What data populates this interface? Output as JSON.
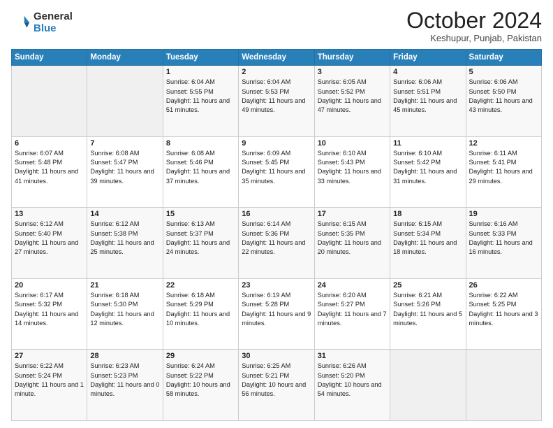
{
  "logo": {
    "general": "General",
    "blue": "Blue"
  },
  "title": "October 2024",
  "location": "Keshupur, Punjab, Pakistan",
  "weekdays": [
    "Sunday",
    "Monday",
    "Tuesday",
    "Wednesday",
    "Thursday",
    "Friday",
    "Saturday"
  ],
  "weeks": [
    [
      {
        "day": "",
        "info": ""
      },
      {
        "day": "",
        "info": ""
      },
      {
        "day": "1",
        "info": "Sunrise: 6:04 AM\nSunset: 5:55 PM\nDaylight: 11 hours and 51 minutes."
      },
      {
        "day": "2",
        "info": "Sunrise: 6:04 AM\nSunset: 5:53 PM\nDaylight: 11 hours and 49 minutes."
      },
      {
        "day": "3",
        "info": "Sunrise: 6:05 AM\nSunset: 5:52 PM\nDaylight: 11 hours and 47 minutes."
      },
      {
        "day": "4",
        "info": "Sunrise: 6:06 AM\nSunset: 5:51 PM\nDaylight: 11 hours and 45 minutes."
      },
      {
        "day": "5",
        "info": "Sunrise: 6:06 AM\nSunset: 5:50 PM\nDaylight: 11 hours and 43 minutes."
      }
    ],
    [
      {
        "day": "6",
        "info": "Sunrise: 6:07 AM\nSunset: 5:48 PM\nDaylight: 11 hours and 41 minutes."
      },
      {
        "day": "7",
        "info": "Sunrise: 6:08 AM\nSunset: 5:47 PM\nDaylight: 11 hours and 39 minutes."
      },
      {
        "day": "8",
        "info": "Sunrise: 6:08 AM\nSunset: 5:46 PM\nDaylight: 11 hours and 37 minutes."
      },
      {
        "day": "9",
        "info": "Sunrise: 6:09 AM\nSunset: 5:45 PM\nDaylight: 11 hours and 35 minutes."
      },
      {
        "day": "10",
        "info": "Sunrise: 6:10 AM\nSunset: 5:43 PM\nDaylight: 11 hours and 33 minutes."
      },
      {
        "day": "11",
        "info": "Sunrise: 6:10 AM\nSunset: 5:42 PM\nDaylight: 11 hours and 31 minutes."
      },
      {
        "day": "12",
        "info": "Sunrise: 6:11 AM\nSunset: 5:41 PM\nDaylight: 11 hours and 29 minutes."
      }
    ],
    [
      {
        "day": "13",
        "info": "Sunrise: 6:12 AM\nSunset: 5:40 PM\nDaylight: 11 hours and 27 minutes."
      },
      {
        "day": "14",
        "info": "Sunrise: 6:12 AM\nSunset: 5:38 PM\nDaylight: 11 hours and 25 minutes."
      },
      {
        "day": "15",
        "info": "Sunrise: 6:13 AM\nSunset: 5:37 PM\nDaylight: 11 hours and 24 minutes."
      },
      {
        "day": "16",
        "info": "Sunrise: 6:14 AM\nSunset: 5:36 PM\nDaylight: 11 hours and 22 minutes."
      },
      {
        "day": "17",
        "info": "Sunrise: 6:15 AM\nSunset: 5:35 PM\nDaylight: 11 hours and 20 minutes."
      },
      {
        "day": "18",
        "info": "Sunrise: 6:15 AM\nSunset: 5:34 PM\nDaylight: 11 hours and 18 minutes."
      },
      {
        "day": "19",
        "info": "Sunrise: 6:16 AM\nSunset: 5:33 PM\nDaylight: 11 hours and 16 minutes."
      }
    ],
    [
      {
        "day": "20",
        "info": "Sunrise: 6:17 AM\nSunset: 5:32 PM\nDaylight: 11 hours and 14 minutes."
      },
      {
        "day": "21",
        "info": "Sunrise: 6:18 AM\nSunset: 5:30 PM\nDaylight: 11 hours and 12 minutes."
      },
      {
        "day": "22",
        "info": "Sunrise: 6:18 AM\nSunset: 5:29 PM\nDaylight: 11 hours and 10 minutes."
      },
      {
        "day": "23",
        "info": "Sunrise: 6:19 AM\nSunset: 5:28 PM\nDaylight: 11 hours and 9 minutes."
      },
      {
        "day": "24",
        "info": "Sunrise: 6:20 AM\nSunset: 5:27 PM\nDaylight: 11 hours and 7 minutes."
      },
      {
        "day": "25",
        "info": "Sunrise: 6:21 AM\nSunset: 5:26 PM\nDaylight: 11 hours and 5 minutes."
      },
      {
        "day": "26",
        "info": "Sunrise: 6:22 AM\nSunset: 5:25 PM\nDaylight: 11 hours and 3 minutes."
      }
    ],
    [
      {
        "day": "27",
        "info": "Sunrise: 6:22 AM\nSunset: 5:24 PM\nDaylight: 11 hours and 1 minute."
      },
      {
        "day": "28",
        "info": "Sunrise: 6:23 AM\nSunset: 5:23 PM\nDaylight: 11 hours and 0 minutes."
      },
      {
        "day": "29",
        "info": "Sunrise: 6:24 AM\nSunset: 5:22 PM\nDaylight: 10 hours and 58 minutes."
      },
      {
        "day": "30",
        "info": "Sunrise: 6:25 AM\nSunset: 5:21 PM\nDaylight: 10 hours and 56 minutes."
      },
      {
        "day": "31",
        "info": "Sunrise: 6:26 AM\nSunset: 5:20 PM\nDaylight: 10 hours and 54 minutes."
      },
      {
        "day": "",
        "info": ""
      },
      {
        "day": "",
        "info": ""
      }
    ]
  ]
}
